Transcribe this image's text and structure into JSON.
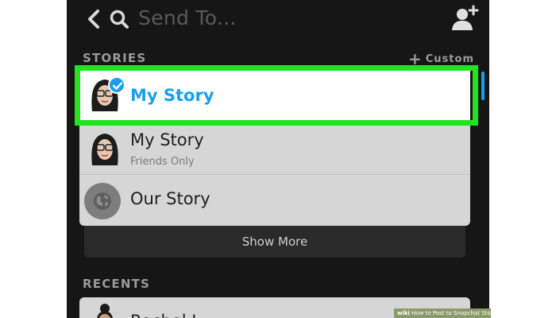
{
  "header": {
    "search_placeholder": "Send To...",
    "icons": [
      "back-icon",
      "search-icon",
      "add-friend-icon"
    ]
  },
  "stories": {
    "section_title": "STORIES",
    "custom_label": "Custom",
    "items": [
      {
        "title": "My Story",
        "selected": true,
        "avatar": "bitmoji-avatar"
      },
      {
        "title": "My Story",
        "subtitle": "Friends Only",
        "avatar": "bitmoji-avatar"
      },
      {
        "title": "Our Story",
        "avatar": "globe-icon"
      }
    ],
    "show_more_label": "Show More"
  },
  "recents": {
    "section_title": "RECENTS",
    "items": [
      {
        "title": "Rachel L."
      }
    ]
  },
  "colors": {
    "background": "#161616",
    "accent_blue": "#1a9ff0",
    "highlight_green": "#22e222",
    "card_gray": "#d6d6d6"
  },
  "watermark": {
    "brand": "wiki",
    "text": "How to Post to Snapchat Stories"
  }
}
